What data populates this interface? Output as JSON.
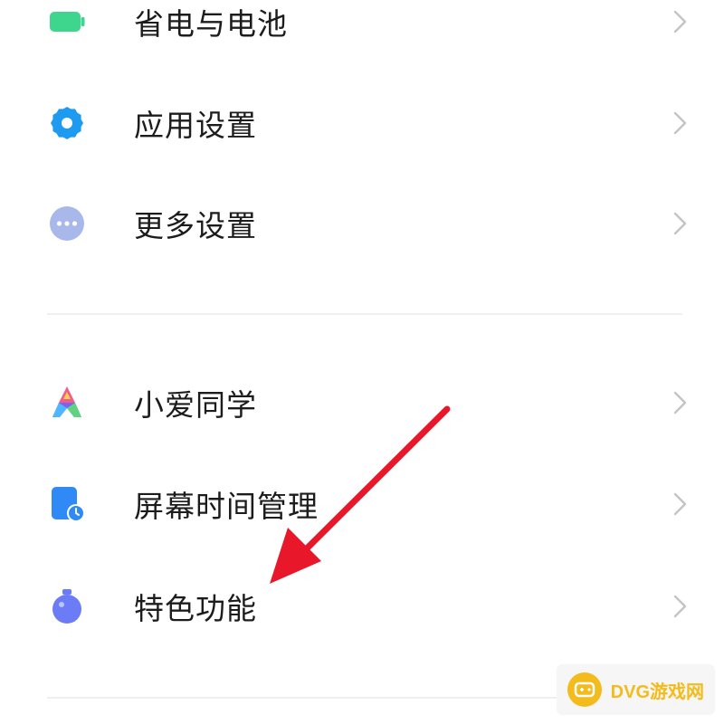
{
  "settings": {
    "items": [
      {
        "label": "省电与电池",
        "icon": "battery-icon"
      },
      {
        "label": "应用设置",
        "icon": "gear-icon"
      },
      {
        "label": "更多设置",
        "icon": "more-dots-icon"
      },
      {
        "label": "小爱同学",
        "icon": "xiaoai-assistant-icon"
      },
      {
        "label": "屏幕时间管理",
        "icon": "screen-time-icon"
      },
      {
        "label": "特色功能",
        "icon": "flask-icon"
      }
    ]
  },
  "watermark": {
    "text": "DVG游戏网"
  },
  "colors": {
    "battery": "#3dd68c",
    "gear": "#1e9bf0",
    "more": "#a9b8ea",
    "screen_time": "#2f8af5",
    "flask": "#6b7cf6",
    "arrow": "#e8182a",
    "chevron": "#c4c4c4",
    "watermark": "#f3bb1b"
  }
}
